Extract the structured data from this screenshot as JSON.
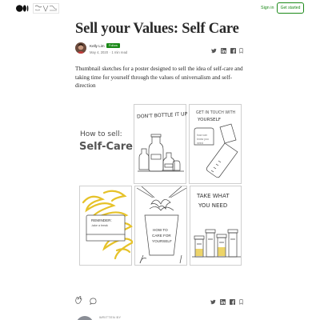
{
  "header": {
    "sign_in": "Sign in",
    "get_started": "Get started",
    "logo_icon": "medium-logo-icon",
    "publication_icon": "publication-logo-icon"
  },
  "article": {
    "title": "Sell your Values: Self Care",
    "author": "Kelly Lim",
    "follow": "Follow",
    "date": "May 4, 2020",
    "separator": "·",
    "read_time": "1 min read",
    "paragraph": "Thumbnail sketches for a poster designed to sell the idea of self-care and taking time for yourself through the values of universalism and self-direction"
  },
  "figures": {
    "poster_line1": "How to sell:",
    "poster_line2": "Self-Care",
    "sketch1_text": "DON'T BOTTLE IT UP",
    "sketch2_line1": "GET IN TOUCH WITH",
    "sketch2_line2": "YOURSELF",
    "sketch2_note1": "how can",
    "sketch2_note2": "know you",
    "sketch2_note3": "need",
    "sketch3_line1": "REMINDER:",
    "sketch3_line2": "-take a break",
    "sketch4_line1": "HOW TO",
    "sketch4_line2": "CARE FOR",
    "sketch4_line3": "YOURSELF",
    "sketch5_line1": "TAKE WHAT",
    "sketch5_line2": "YOU NEED"
  },
  "footer": {
    "written_by": "WRITTEN BY"
  },
  "colors": {
    "brand_green": "#1a8917",
    "sketch_yellow": "#e6c229",
    "text": "#292929"
  }
}
